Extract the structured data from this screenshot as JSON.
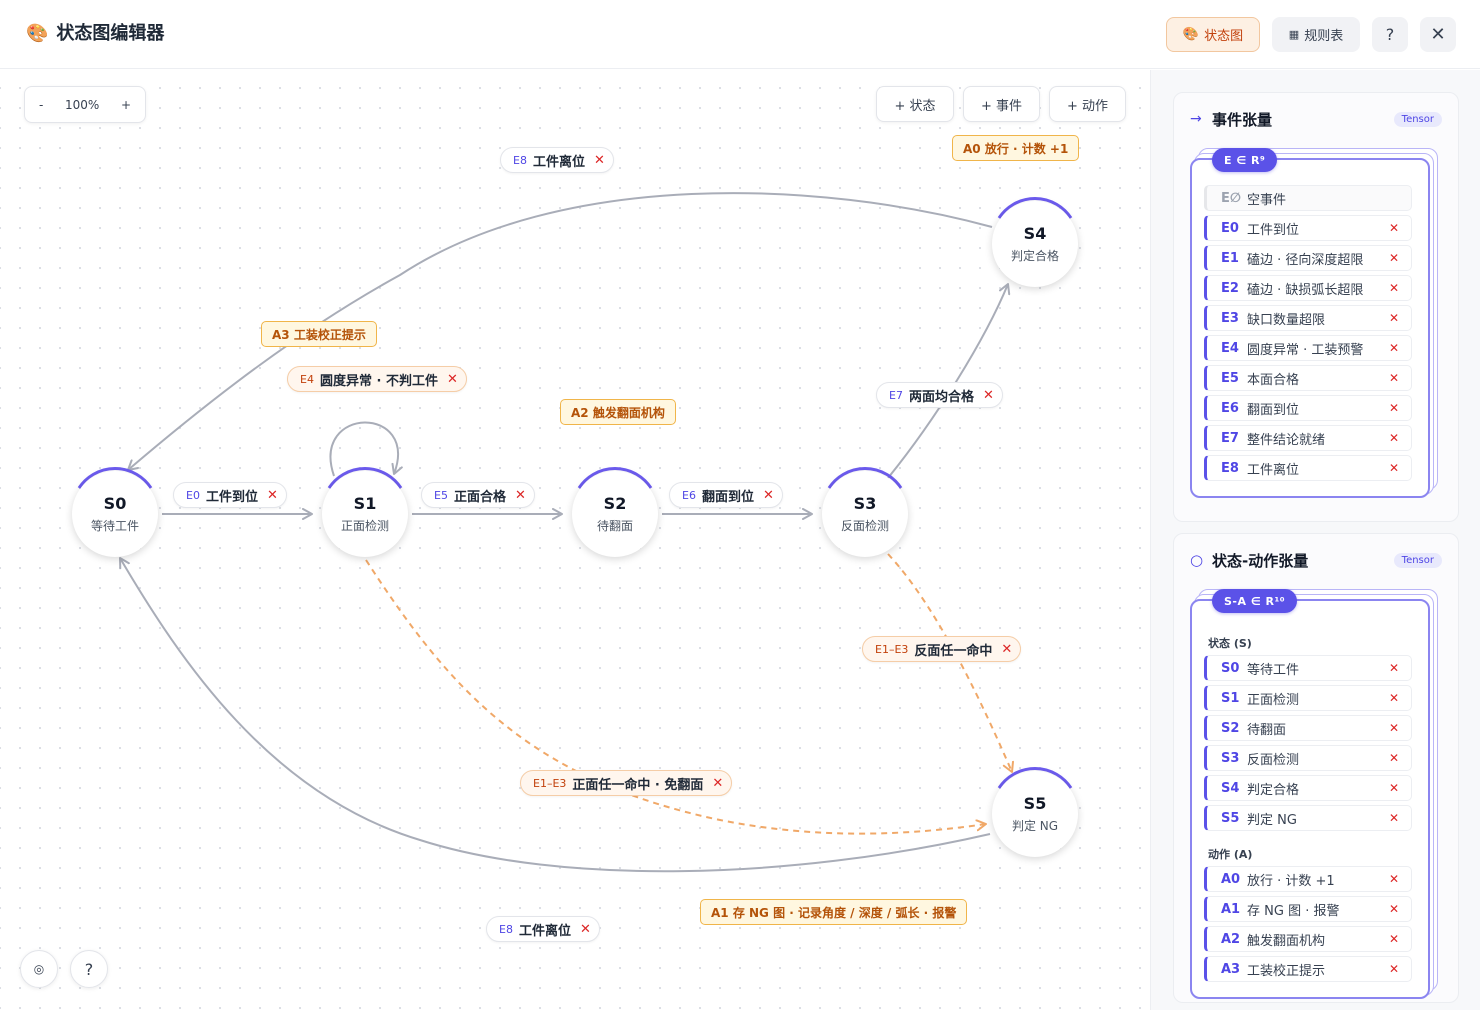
{
  "header": {
    "logo_icon": "palette-icon",
    "title": "状态图编辑器",
    "btn_state": "状态图",
    "btn_table": "规则表",
    "btn_help": "?",
    "btn_close": "✕"
  },
  "toolbar": {
    "zoom_minus": "-",
    "zoom_level": "100%",
    "zoom_plus": "+",
    "add_state": "+ 状态",
    "add_event": "+ 事件",
    "add_action": "+ 动作"
  },
  "diagram": {
    "nodes": {
      "s0": {
        "id": "S0",
        "name": "等待工件"
      },
      "s1": {
        "id": "S1",
        "name": "正面检测"
      },
      "s2": {
        "id": "S2",
        "name": "待翻面"
      },
      "s3": {
        "id": "S3",
        "name": "反面检测"
      },
      "s4": {
        "id": "S4",
        "name": "判定合格"
      },
      "s5": {
        "id": "S5",
        "name": "判定 NG"
      }
    },
    "events": {
      "e8_top": {
        "id": "E8",
        "text": "工件离位"
      },
      "e4": {
        "id": "E4",
        "text": "圆度异常 · 不判工件"
      },
      "e7": {
        "id": "E7",
        "text": "两面均合格"
      },
      "e0": {
        "id": "E0",
        "text": "工件到位"
      },
      "e5": {
        "id": "E5",
        "text": "正面合格"
      },
      "e6": {
        "id": "E6",
        "text": "翻面到位"
      },
      "e13_back": {
        "id": "E1–E3",
        "text": "反面任一命中"
      },
      "e13_front": {
        "id": "E1–E3",
        "text": "正面任一命中 · 免翻面"
      },
      "e8_bottom": {
        "id": "E8",
        "text": "工件离位"
      },
      "remove": "✕"
    },
    "actions": {
      "a0": "A0 放行 · 计数 +1",
      "a3": "A3 工装校正提示",
      "a2": "A2 触发翻面机构",
      "a1": "A1 存 NG 图 · 记录角度 / 深度 / 弧长 · 报警"
    }
  },
  "corner": {
    "locate": "◎",
    "help": "?"
  },
  "sidebar": {
    "events_card": {
      "title": "事件张量",
      "badge": "Tensor",
      "tag": "E ∈ R⁹",
      "empty": {
        "id": "E∅",
        "text": "空事件"
      },
      "items": [
        {
          "id": "E0",
          "text": "工件到位"
        },
        {
          "id": "E1",
          "text": "磕边 · 径向深度超限"
        },
        {
          "id": "E2",
          "text": "磕边 · 缺损弧长超限"
        },
        {
          "id": "E3",
          "text": "缺口数量超限"
        },
        {
          "id": "E4",
          "text": "圆度异常 · 工装预警"
        },
        {
          "id": "E5",
          "text": "本面合格"
        },
        {
          "id": "E6",
          "text": "翻面到位"
        },
        {
          "id": "E7",
          "text": "整件结论就绪"
        },
        {
          "id": "E8",
          "text": "工件离位"
        }
      ]
    },
    "sa_card": {
      "title": "状态-动作张量",
      "badge": "Tensor",
      "tag": "S-A ∈ R¹⁰",
      "states_heading": "状态 (S)",
      "actions_heading": "动作 (A)",
      "states": [
        {
          "id": "S0",
          "text": "等待工件"
        },
        {
          "id": "S1",
          "text": "正面检测"
        },
        {
          "id": "S2",
          "text": "待翻面"
        },
        {
          "id": "S3",
          "text": "反面检测"
        },
        {
          "id": "S4",
          "text": "判定合格"
        },
        {
          "id": "S5",
          "text": "判定 NG"
        }
      ],
      "actions": [
        {
          "id": "A0",
          "text": "放行 · 计数 +1"
        },
        {
          "id": "A1",
          "text": "存 NG 图 · 报警"
        },
        {
          "id": "A2",
          "text": "触发翻面机构"
        },
        {
          "id": "A3",
          "text": "工装校正提示"
        }
      ]
    }
  },
  "colors": {
    "accent": "#5b52e8",
    "edge": "#a9adb8",
    "ng_edge": "#f0a868",
    "remove": "#dc2626",
    "action_bg": "#fff7e0"
  }
}
